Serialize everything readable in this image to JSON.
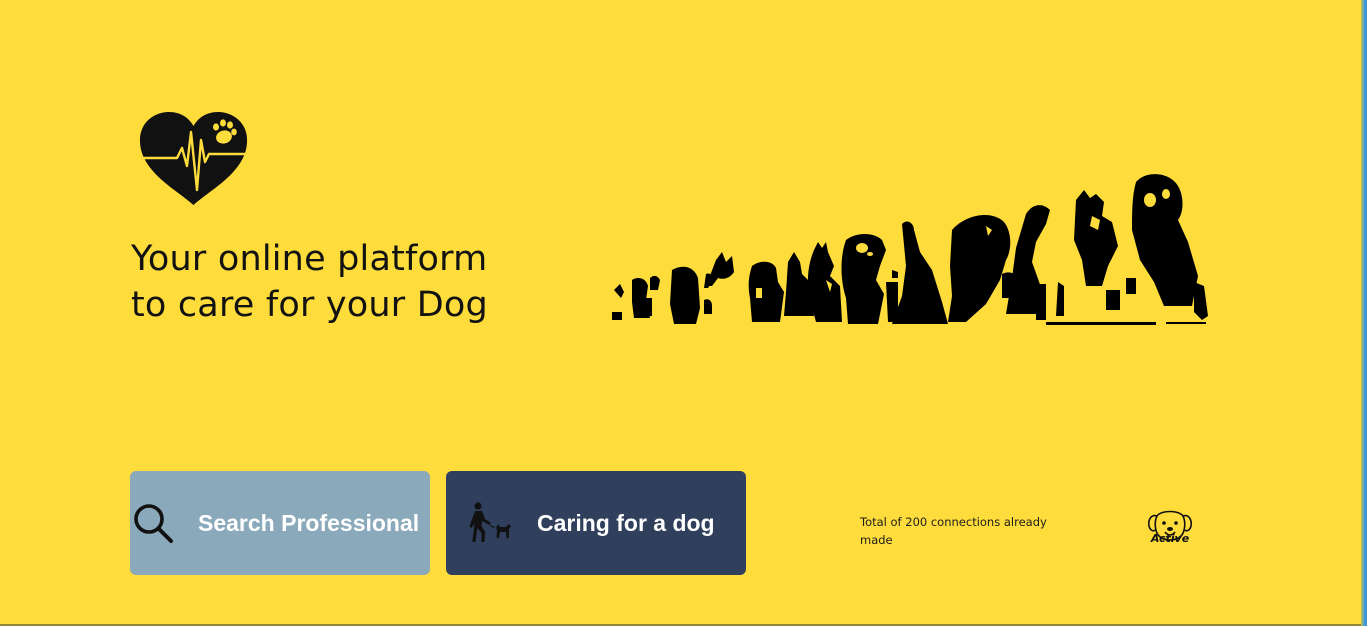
{
  "hero": {
    "headline_line1": "Your online platform",
    "headline_line2": "to care for your Dog"
  },
  "icons": {
    "logo": "heart-paw-heartbeat-icon",
    "dogs": "dogs-silhouette-illustration",
    "search": "search-icon",
    "care": "person-walking-dog-icon",
    "mascot": "dog-face-icon"
  },
  "actions": {
    "search_label": "Search Professional",
    "care_label": "Caring for a dog"
  },
  "stats": {
    "text": "Total of 200 connections already made"
  },
  "mascot": {
    "label": "Active"
  },
  "colors": {
    "background": "#FEDC3C",
    "search_button": "#8AAABB",
    "care_button": "#2F3F5C"
  }
}
